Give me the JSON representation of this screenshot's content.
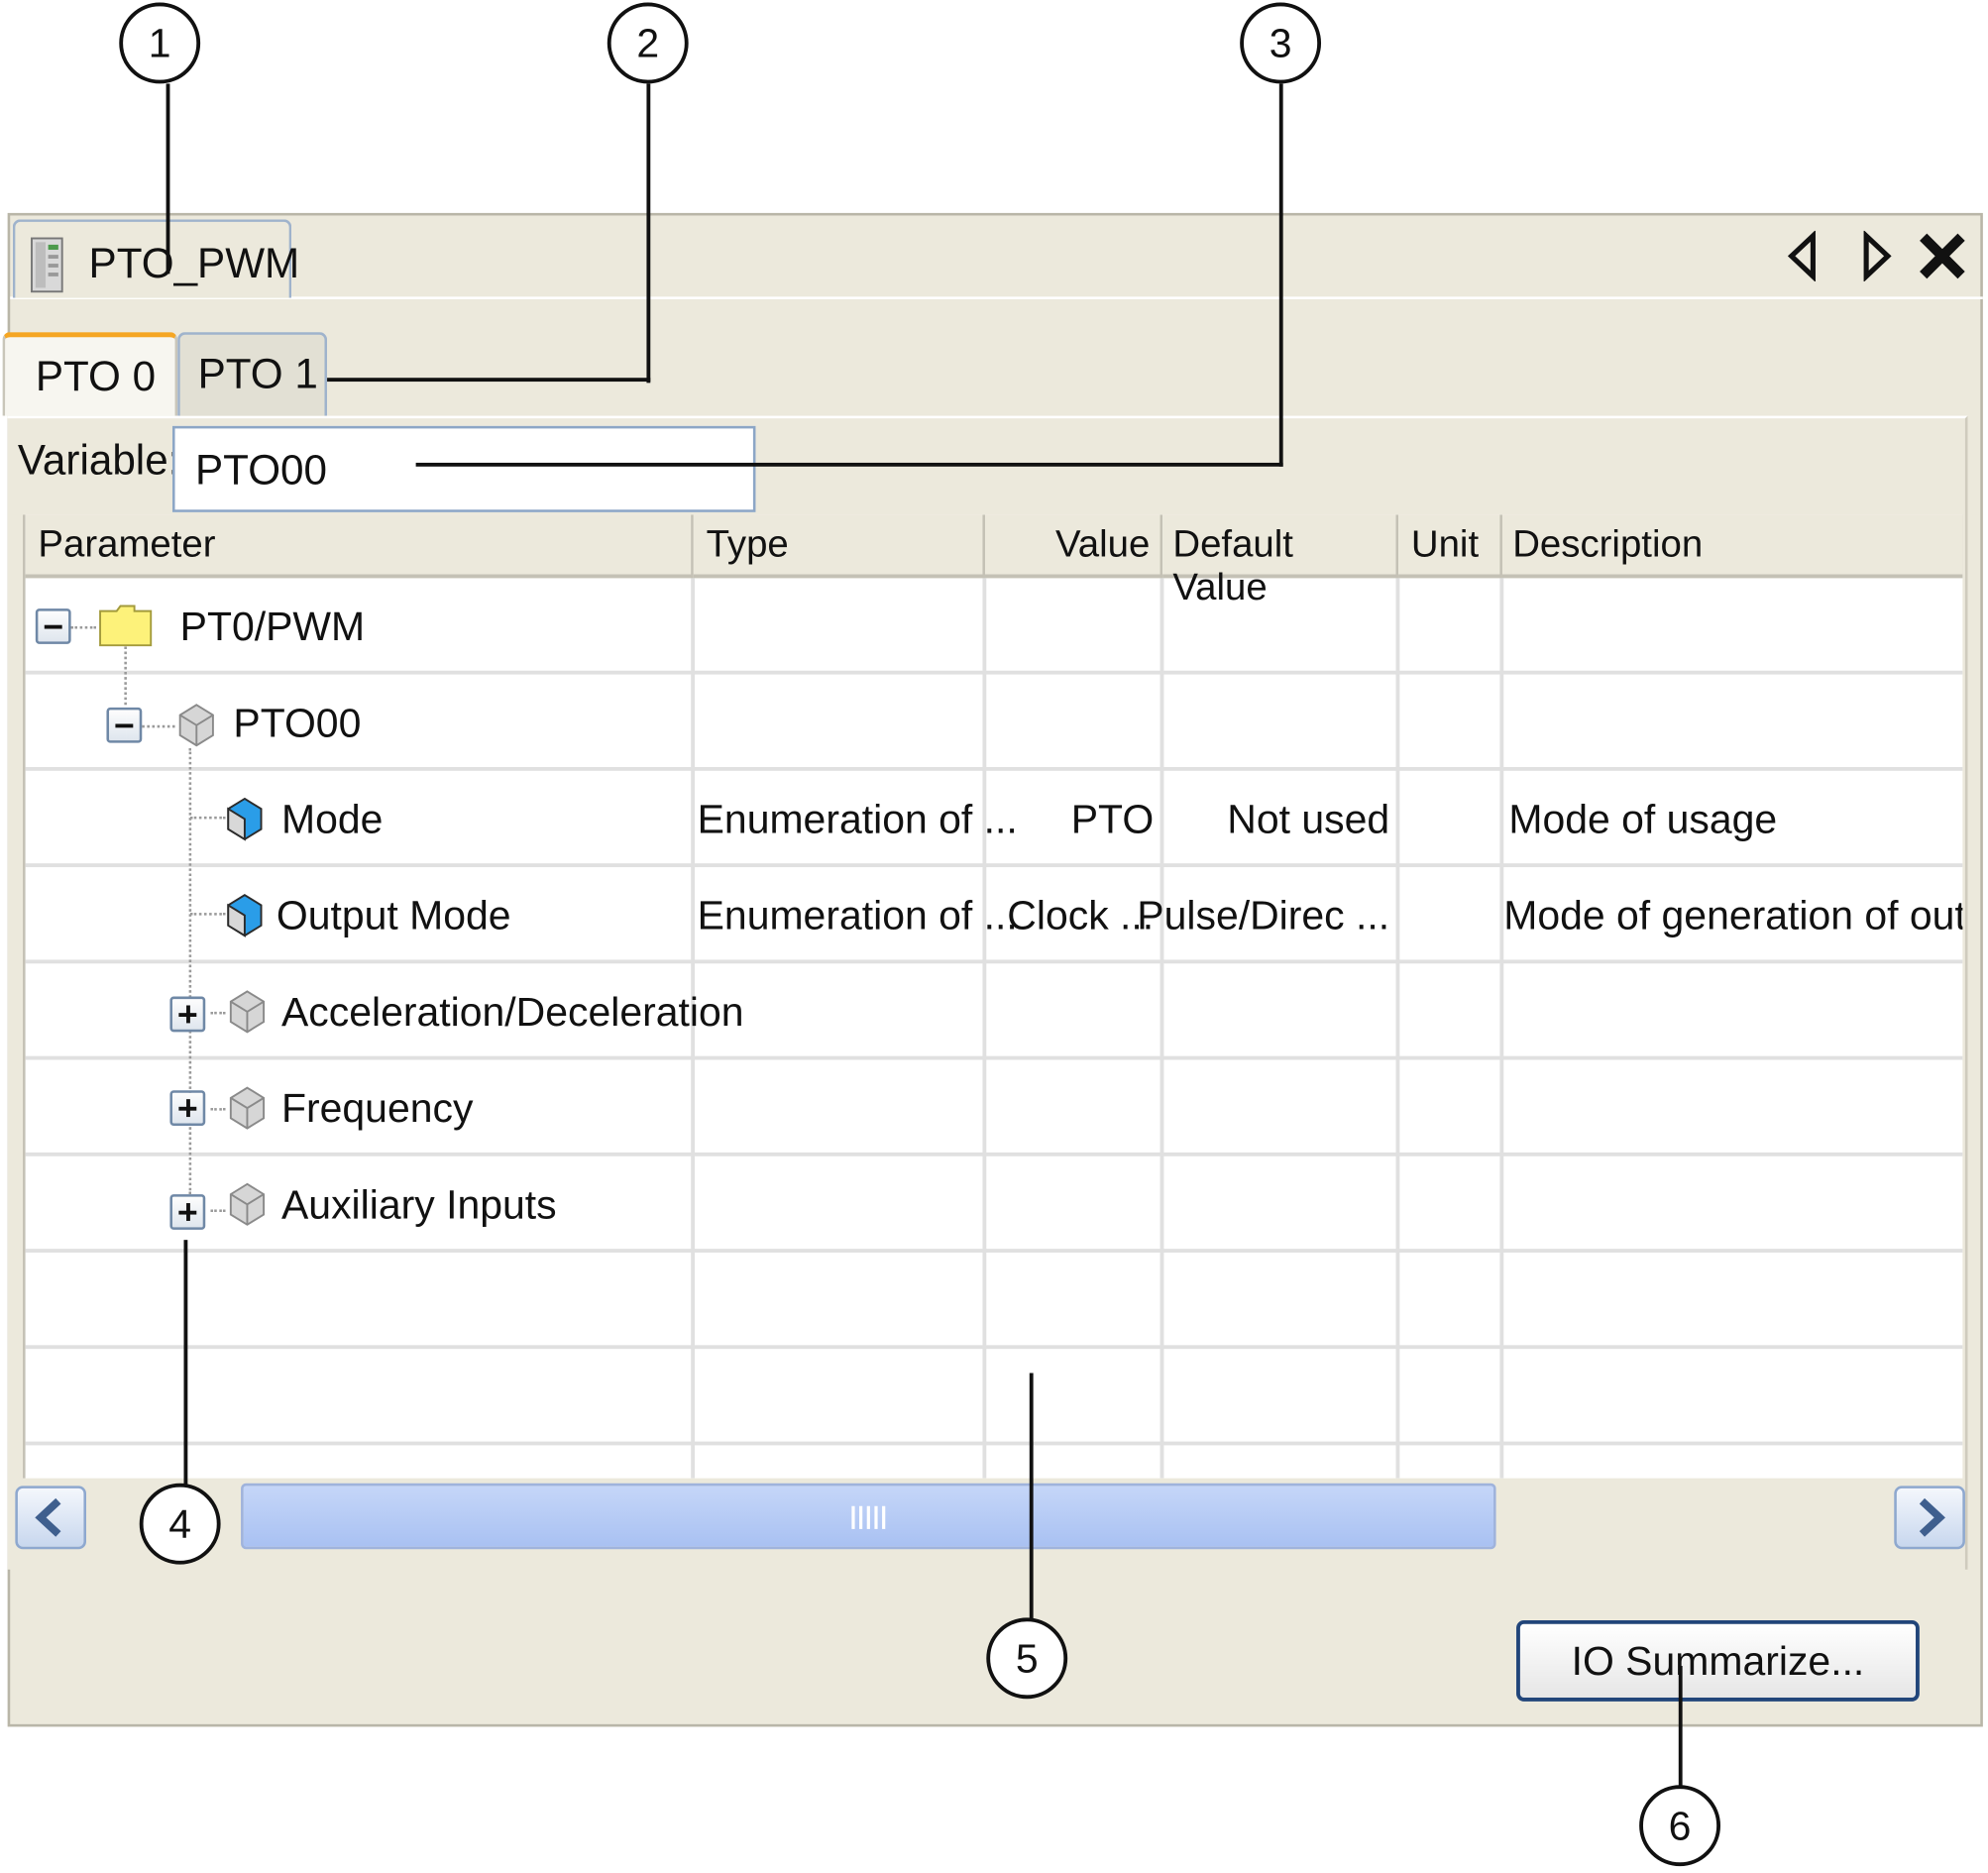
{
  "window": {
    "doc_tab_label": "PTO_PWM"
  },
  "channel_tabs": [
    {
      "label": "PTO 0"
    },
    {
      "label": "PTO 1"
    }
  ],
  "variable": {
    "label": "Variable:",
    "value": "PTO00"
  },
  "grid": {
    "columns": [
      "Parameter",
      "Type",
      "Value",
      "Default Value",
      "Unit",
      "Description"
    ],
    "rows": [
      {
        "parameter": "PT0/PWM",
        "type": "",
        "value": "",
        "default": "",
        "unit": "",
        "description": "",
        "icon": "folder-icon",
        "expander": "collapse"
      },
      {
        "parameter": "PTO00",
        "type": "",
        "value": "",
        "default": "",
        "unit": "",
        "description": "",
        "icon": "gray-cube-icon",
        "expander": "collapse"
      },
      {
        "parameter": "Mode",
        "type": "Enumeration of ...",
        "value": "PTO",
        "default": "Not used",
        "unit": "",
        "description": "Mode of usage",
        "icon": "blue-cube-icon"
      },
      {
        "parameter": "Output Mode",
        "type": "Enumeration of ...",
        "value": "Clock ...",
        "default": "Pulse/Direc ...",
        "unit": "",
        "description": "Mode of generation of out ...",
        "icon": "blue-cube-icon"
      },
      {
        "parameter": "Acceleration/Deceleration",
        "type": "",
        "value": "",
        "default": "",
        "unit": "",
        "description": "",
        "icon": "gray-cube-icon",
        "expander": "expand"
      },
      {
        "parameter": "Frequency",
        "type": "",
        "value": "",
        "default": "",
        "unit": "",
        "description": "",
        "icon": "gray-cube-icon",
        "expander": "expand"
      },
      {
        "parameter": "Auxiliary Inputs",
        "type": "",
        "value": "",
        "default": "",
        "unit": "",
        "description": "",
        "icon": "gray-cube-icon",
        "expander": "expand"
      }
    ]
  },
  "buttons": {
    "io_summarize": "IO Summarize..."
  },
  "callouts": [
    "1",
    "2",
    "3",
    "4",
    "5",
    "6"
  ],
  "colors": {
    "panel": "#ece9dc",
    "active_tab_accent": "#f5a623",
    "button_border": "#21457a",
    "scroll_thumb": "#a9c1f2"
  }
}
